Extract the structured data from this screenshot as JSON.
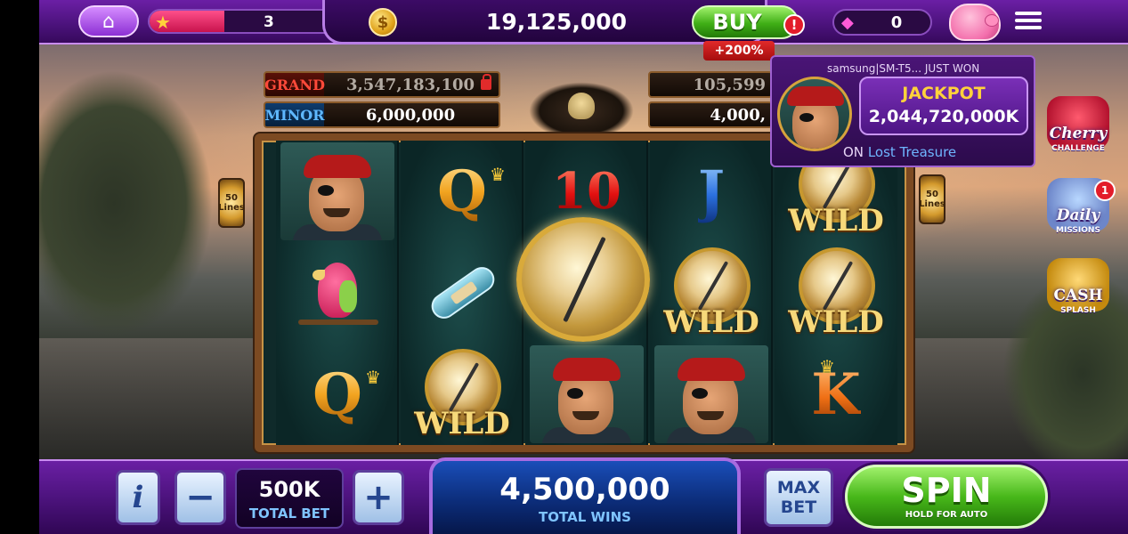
{
  "topbar": {
    "home_icon": "home-icon",
    "level": {
      "number": "3",
      "progress_fraction": 0.4,
      "star_icon": "star-icon"
    },
    "coins": {
      "amount": "19,125,000",
      "icon": "coin-icon"
    },
    "buy": {
      "label": "BUY",
      "alert": "!",
      "bonus": "+200%"
    },
    "gems": {
      "count": "0",
      "icon": "gem-icon"
    },
    "piggy_icon": "piggy-bank-icon",
    "menu_icon": "hamburger-menu-icon"
  },
  "jackpots": {
    "grand": {
      "label": "GRAND",
      "value": "3,547,183,100"
    },
    "minor": {
      "label": "MINOR",
      "value": "6,000,000"
    },
    "major_partial": {
      "value": "105,599"
    },
    "mini_partial": {
      "value": "4,000,"
    }
  },
  "lanterns": {
    "left": "50 Lines",
    "right": "50 Lines"
  },
  "reels": [
    [
      "pirate",
      "parrot",
      "Q"
    ],
    [
      "Q",
      "bottle",
      "WILD"
    ],
    [
      "10",
      "compass",
      "pirate"
    ],
    [
      "J",
      "WILD",
      "pirate"
    ],
    [
      "WILD",
      "WILD",
      "K"
    ]
  ],
  "symbols": {
    "wild_text": "WILD",
    "q": "Q",
    "ten": "10",
    "j": "J",
    "k": "K"
  },
  "win_popup": {
    "player": "samsung|SM-T5...",
    "headline": "JUST WON",
    "label": "JACKPOT",
    "amount": "2,044,720,000K",
    "on": "ON",
    "game": "Lost Treasure"
  },
  "features": {
    "cherry": {
      "title": "Cherry",
      "sub": "CHALLENGE"
    },
    "daily": {
      "title": "Daily",
      "sub": "MISSIONS",
      "badge": "1"
    },
    "cash": {
      "title": "CASH",
      "sub": "SPLASH"
    }
  },
  "bottombar": {
    "info": "i",
    "minus": "−",
    "plus": "+",
    "bet_value": "500K",
    "bet_label": "TOTAL BET",
    "wins_value": "4,500,000",
    "wins_label": "TOTAL WINS",
    "max_bet": "MAX BET",
    "spin": "SPIN",
    "spin_sub": "HOLD FOR AUTO"
  }
}
